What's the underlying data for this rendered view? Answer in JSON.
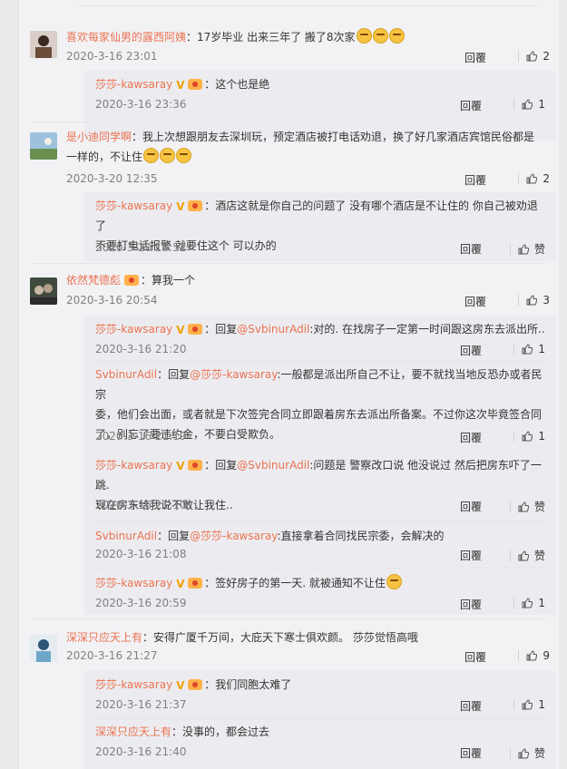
{
  "ui": {
    "reply_label": "回覆",
    "like_icon": "thumbs-up-icon"
  },
  "comments": [
    {
      "author": "喜欢每家仙男的露西阿姨",
      "text": "：17岁毕业 出来三年了 搬了8次家",
      "emojis": 3,
      "time": "2020-3-16 23:01",
      "likes": "2",
      "replies": [
        {
          "author": "莎莎-kawsaray",
          "verified": true,
          "text": "：这个也是绝",
          "time": "2020-3-16 23:36",
          "likes": "1"
        }
      ]
    },
    {
      "author": "是小迪同学啊",
      "text_line1": "：我上次想跟朋友去深圳玩，预定酒店被打电话劝退，换了好几家酒店宾馆民俗都是",
      "text_line2": "一样的，不让住",
      "emojis": 3,
      "time": "2020-3-20 12:35",
      "likes": "2",
      "replies": [
        {
          "author": "莎莎-kawsaray",
          "verified": true,
          "text_line1": "：酒店这就是你自己的问题了 没有哪个酒店是不让住的 你自己被劝退了",
          "text_line2": "不要打电话报警 就要住这个 可以办的",
          "time": "2020-3-20 16:52",
          "likes": "赞"
        }
      ]
    },
    {
      "author": "依然梵德彪",
      "text": "：算我一个",
      "time": "2020-3-16 20:54",
      "likes": "3",
      "replies": [
        {
          "author": "莎莎-kawsaray",
          "verified": true,
          "prefix": "：回复",
          "mention": "@SvbinurAdil",
          "text": ":对的. 在找房子一定第一时间跟这房东去派出所..",
          "time": "2020-3-16 21:20",
          "likes": "1"
        },
        {
          "author": "SvbinurAdil",
          "prefix": "：回复",
          "mention": "@莎莎-kawsaray",
          "text_line1": ":一般都是派出所自己不让，要不就找当地反恐办或者民宗",
          "text_line2": "委，他们会出面，或者就是下次签完合同立即跟着房东去派出所备案。不过你这次毕竟签合同",
          "text_line3": "了，别忘了要违约金，不要白受欺负。",
          "time": "2020-3-16 21:19",
          "likes": "1"
        },
        {
          "author": "莎莎-kawsaray",
          "verified": true,
          "prefix": "：回复",
          "mention": "@SvbinurAdil",
          "text_line1": ":问题是 警察改口说 他没说过 然后把房东吓了一跳.",
          "text_line2": "现在房东给我说不敢让我住..",
          "time": "2020-3-16 21:10",
          "likes": "赞"
        },
        {
          "author": "SvbinurAdil",
          "prefix": "：回复",
          "mention": "@莎莎-kawsaray",
          "text": ":直接拿着合同找民宗委，会解决的",
          "time": "2020-3-16 21:08",
          "likes": "赞"
        },
        {
          "author": "莎莎-kawsaray",
          "verified": true,
          "text": "：签好房子的第一天. 就被通知不让住",
          "emojis": 1,
          "time": "2020-3-16 20:59",
          "likes": "1"
        }
      ]
    },
    {
      "author": "深深只应天上有",
      "text": "：安得广厦千万间，大庇天下寒士俱欢颜。 莎莎觉悟高哦",
      "time": "2020-3-16 21:27",
      "likes": "9",
      "replies": [
        {
          "author": "莎莎-kawsaray",
          "verified": true,
          "text": "：我们同胞太难了",
          "time": "2020-3-16 21:37",
          "likes": "1"
        },
        {
          "author": "深深只应天上有",
          "text": "：没事的，都会过去",
          "time": "2020-3-16 21:40",
          "likes": "赞"
        }
      ]
    }
  ]
}
